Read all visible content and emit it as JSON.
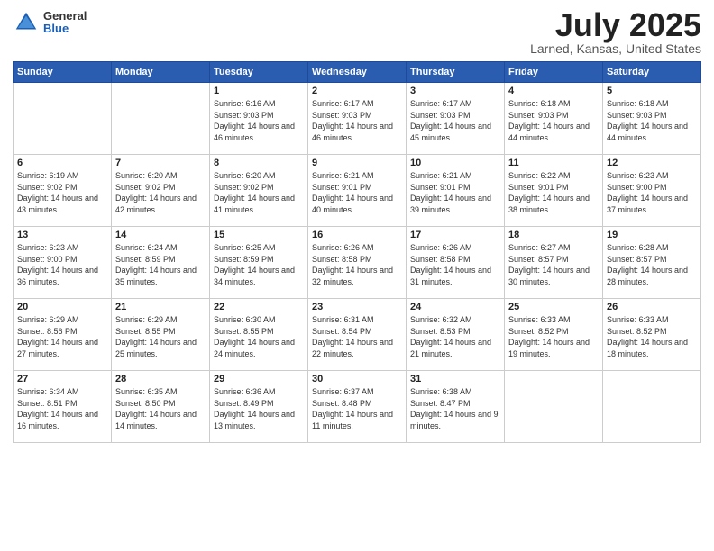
{
  "logo": {
    "general": "General",
    "blue": "Blue"
  },
  "title": {
    "month_year": "July 2025",
    "location": "Larned, Kansas, United States"
  },
  "weekdays": [
    "Sunday",
    "Monday",
    "Tuesday",
    "Wednesday",
    "Thursday",
    "Friday",
    "Saturday"
  ],
  "weeks": [
    [
      {
        "date": "",
        "sunrise": "",
        "sunset": "",
        "daylight": ""
      },
      {
        "date": "",
        "sunrise": "",
        "sunset": "",
        "daylight": ""
      },
      {
        "date": "1",
        "sunrise": "Sunrise: 6:16 AM",
        "sunset": "Sunset: 9:03 PM",
        "daylight": "Daylight: 14 hours and 46 minutes."
      },
      {
        "date": "2",
        "sunrise": "Sunrise: 6:17 AM",
        "sunset": "Sunset: 9:03 PM",
        "daylight": "Daylight: 14 hours and 46 minutes."
      },
      {
        "date": "3",
        "sunrise": "Sunrise: 6:17 AM",
        "sunset": "Sunset: 9:03 PM",
        "daylight": "Daylight: 14 hours and 45 minutes."
      },
      {
        "date": "4",
        "sunrise": "Sunrise: 6:18 AM",
        "sunset": "Sunset: 9:03 PM",
        "daylight": "Daylight: 14 hours and 44 minutes."
      },
      {
        "date": "5",
        "sunrise": "Sunrise: 6:18 AM",
        "sunset": "Sunset: 9:03 PM",
        "daylight": "Daylight: 14 hours and 44 minutes."
      }
    ],
    [
      {
        "date": "6",
        "sunrise": "Sunrise: 6:19 AM",
        "sunset": "Sunset: 9:02 PM",
        "daylight": "Daylight: 14 hours and 43 minutes."
      },
      {
        "date": "7",
        "sunrise": "Sunrise: 6:20 AM",
        "sunset": "Sunset: 9:02 PM",
        "daylight": "Daylight: 14 hours and 42 minutes."
      },
      {
        "date": "8",
        "sunrise": "Sunrise: 6:20 AM",
        "sunset": "Sunset: 9:02 PM",
        "daylight": "Daylight: 14 hours and 41 minutes."
      },
      {
        "date": "9",
        "sunrise": "Sunrise: 6:21 AM",
        "sunset": "Sunset: 9:01 PM",
        "daylight": "Daylight: 14 hours and 40 minutes."
      },
      {
        "date": "10",
        "sunrise": "Sunrise: 6:21 AM",
        "sunset": "Sunset: 9:01 PM",
        "daylight": "Daylight: 14 hours and 39 minutes."
      },
      {
        "date": "11",
        "sunrise": "Sunrise: 6:22 AM",
        "sunset": "Sunset: 9:01 PM",
        "daylight": "Daylight: 14 hours and 38 minutes."
      },
      {
        "date": "12",
        "sunrise": "Sunrise: 6:23 AM",
        "sunset": "Sunset: 9:00 PM",
        "daylight": "Daylight: 14 hours and 37 minutes."
      }
    ],
    [
      {
        "date": "13",
        "sunrise": "Sunrise: 6:23 AM",
        "sunset": "Sunset: 9:00 PM",
        "daylight": "Daylight: 14 hours and 36 minutes."
      },
      {
        "date": "14",
        "sunrise": "Sunrise: 6:24 AM",
        "sunset": "Sunset: 8:59 PM",
        "daylight": "Daylight: 14 hours and 35 minutes."
      },
      {
        "date": "15",
        "sunrise": "Sunrise: 6:25 AM",
        "sunset": "Sunset: 8:59 PM",
        "daylight": "Daylight: 14 hours and 34 minutes."
      },
      {
        "date": "16",
        "sunrise": "Sunrise: 6:26 AM",
        "sunset": "Sunset: 8:58 PM",
        "daylight": "Daylight: 14 hours and 32 minutes."
      },
      {
        "date": "17",
        "sunrise": "Sunrise: 6:26 AM",
        "sunset": "Sunset: 8:58 PM",
        "daylight": "Daylight: 14 hours and 31 minutes."
      },
      {
        "date": "18",
        "sunrise": "Sunrise: 6:27 AM",
        "sunset": "Sunset: 8:57 PM",
        "daylight": "Daylight: 14 hours and 30 minutes."
      },
      {
        "date": "19",
        "sunrise": "Sunrise: 6:28 AM",
        "sunset": "Sunset: 8:57 PM",
        "daylight": "Daylight: 14 hours and 28 minutes."
      }
    ],
    [
      {
        "date": "20",
        "sunrise": "Sunrise: 6:29 AM",
        "sunset": "Sunset: 8:56 PM",
        "daylight": "Daylight: 14 hours and 27 minutes."
      },
      {
        "date": "21",
        "sunrise": "Sunrise: 6:29 AM",
        "sunset": "Sunset: 8:55 PM",
        "daylight": "Daylight: 14 hours and 25 minutes."
      },
      {
        "date": "22",
        "sunrise": "Sunrise: 6:30 AM",
        "sunset": "Sunset: 8:55 PM",
        "daylight": "Daylight: 14 hours and 24 minutes."
      },
      {
        "date": "23",
        "sunrise": "Sunrise: 6:31 AM",
        "sunset": "Sunset: 8:54 PM",
        "daylight": "Daylight: 14 hours and 22 minutes."
      },
      {
        "date": "24",
        "sunrise": "Sunrise: 6:32 AM",
        "sunset": "Sunset: 8:53 PM",
        "daylight": "Daylight: 14 hours and 21 minutes."
      },
      {
        "date": "25",
        "sunrise": "Sunrise: 6:33 AM",
        "sunset": "Sunset: 8:52 PM",
        "daylight": "Daylight: 14 hours and 19 minutes."
      },
      {
        "date": "26",
        "sunrise": "Sunrise: 6:33 AM",
        "sunset": "Sunset: 8:52 PM",
        "daylight": "Daylight: 14 hours and 18 minutes."
      }
    ],
    [
      {
        "date": "27",
        "sunrise": "Sunrise: 6:34 AM",
        "sunset": "Sunset: 8:51 PM",
        "daylight": "Daylight: 14 hours and 16 minutes."
      },
      {
        "date": "28",
        "sunrise": "Sunrise: 6:35 AM",
        "sunset": "Sunset: 8:50 PM",
        "daylight": "Daylight: 14 hours and 14 minutes."
      },
      {
        "date": "29",
        "sunrise": "Sunrise: 6:36 AM",
        "sunset": "Sunset: 8:49 PM",
        "daylight": "Daylight: 14 hours and 13 minutes."
      },
      {
        "date": "30",
        "sunrise": "Sunrise: 6:37 AM",
        "sunset": "Sunset: 8:48 PM",
        "daylight": "Daylight: 14 hours and 11 minutes."
      },
      {
        "date": "31",
        "sunrise": "Sunrise: 6:38 AM",
        "sunset": "Sunset: 8:47 PM",
        "daylight": "Daylight: 14 hours and 9 minutes."
      },
      {
        "date": "",
        "sunrise": "",
        "sunset": "",
        "daylight": ""
      },
      {
        "date": "",
        "sunrise": "",
        "sunset": "",
        "daylight": ""
      }
    ]
  ]
}
